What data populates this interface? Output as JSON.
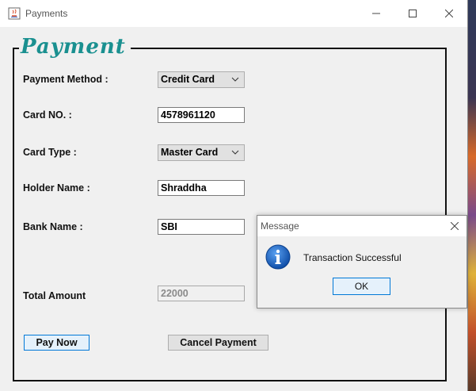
{
  "window": {
    "title": "Payments",
    "icon": "java-app-icon",
    "controls": [
      "minimize-icon",
      "maximize-icon",
      "close-icon"
    ]
  },
  "panel": {
    "legend": "Payment"
  },
  "form": {
    "payment_method": {
      "label": "Payment Method :",
      "value": "Credit Card"
    },
    "card_no": {
      "label": "Card NO. :",
      "value": "4578961120"
    },
    "card_type": {
      "label": "Card Type :",
      "value": "Master Card"
    },
    "holder_name": {
      "label": "Holder Name :",
      "value": "Shraddha"
    },
    "bank_name": {
      "label": "Bank Name :",
      "value": "SBI"
    },
    "total_amount": {
      "label": "Total Amount",
      "value": "22000"
    }
  },
  "buttons": {
    "pay_now": "Pay Now",
    "cancel_payment": "Cancel Payment"
  },
  "dialog": {
    "title": "Message",
    "message": "Transaction Successful",
    "ok": "OK",
    "icon": "info-icon"
  },
  "colors": {
    "legend": "#1a9090",
    "focus": "#0078d7",
    "info_blue": "#1560bd"
  }
}
